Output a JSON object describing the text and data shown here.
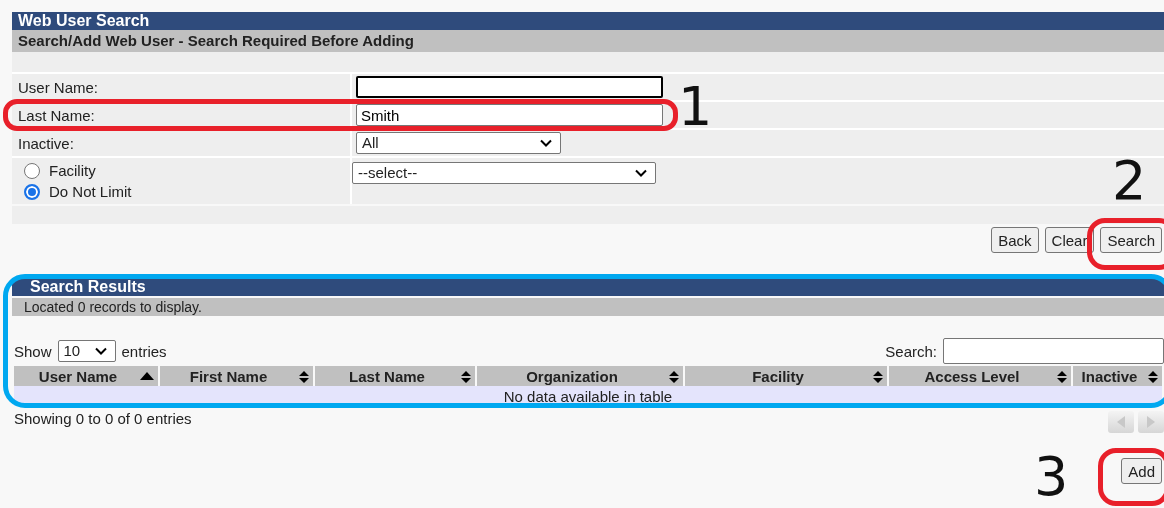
{
  "header": {
    "title": "Web User Search",
    "subtitle": "Search/Add Web User - Search Required Before Adding"
  },
  "form": {
    "fields": [
      {
        "kind": "text",
        "label": "User Name:",
        "focused": true
      },
      {
        "kind": "text",
        "label": "Last Name:",
        "value": "Smith",
        "focused": false
      },
      {
        "kind": "select",
        "label": "Inactive:",
        "value": "All"
      }
    ],
    "limit_options": [
      {
        "label": "Facility",
        "selected": false
      },
      {
        "label": "Do Not Limit",
        "selected": true
      }
    ],
    "facility_select": "--select--"
  },
  "buttons": [
    "Back",
    "Clear",
    "Search"
  ],
  "results": {
    "title": "Search Results",
    "message": "Located 0 records to display.",
    "show_label": "Show",
    "page_size": "10",
    "entries_label": "entries",
    "search_label": "Search:",
    "columns": [
      {
        "label": "User Name",
        "sorted": true
      },
      {
        "label": "First Name",
        "sorted": false
      },
      {
        "label": "Last Name",
        "sorted": false
      },
      {
        "label": "Organization",
        "sorted": false
      },
      {
        "label": "Facility",
        "sorted": false
      },
      {
        "label": "Access Level",
        "sorted": false
      },
      {
        "label": "Inactive",
        "sorted": false
      }
    ],
    "empty": "No data available in table",
    "info": "Showing 0 to 0 of 0 entries"
  },
  "add_button": "Add",
  "annotations": [
    {
      "number": "1",
      "color": "#e8202a"
    },
    {
      "number": "2",
      "color": "#e8202a"
    },
    {
      "number": "3",
      "color": "#e8202a"
    },
    {
      "color": "#00a8f0"
    }
  ]
}
